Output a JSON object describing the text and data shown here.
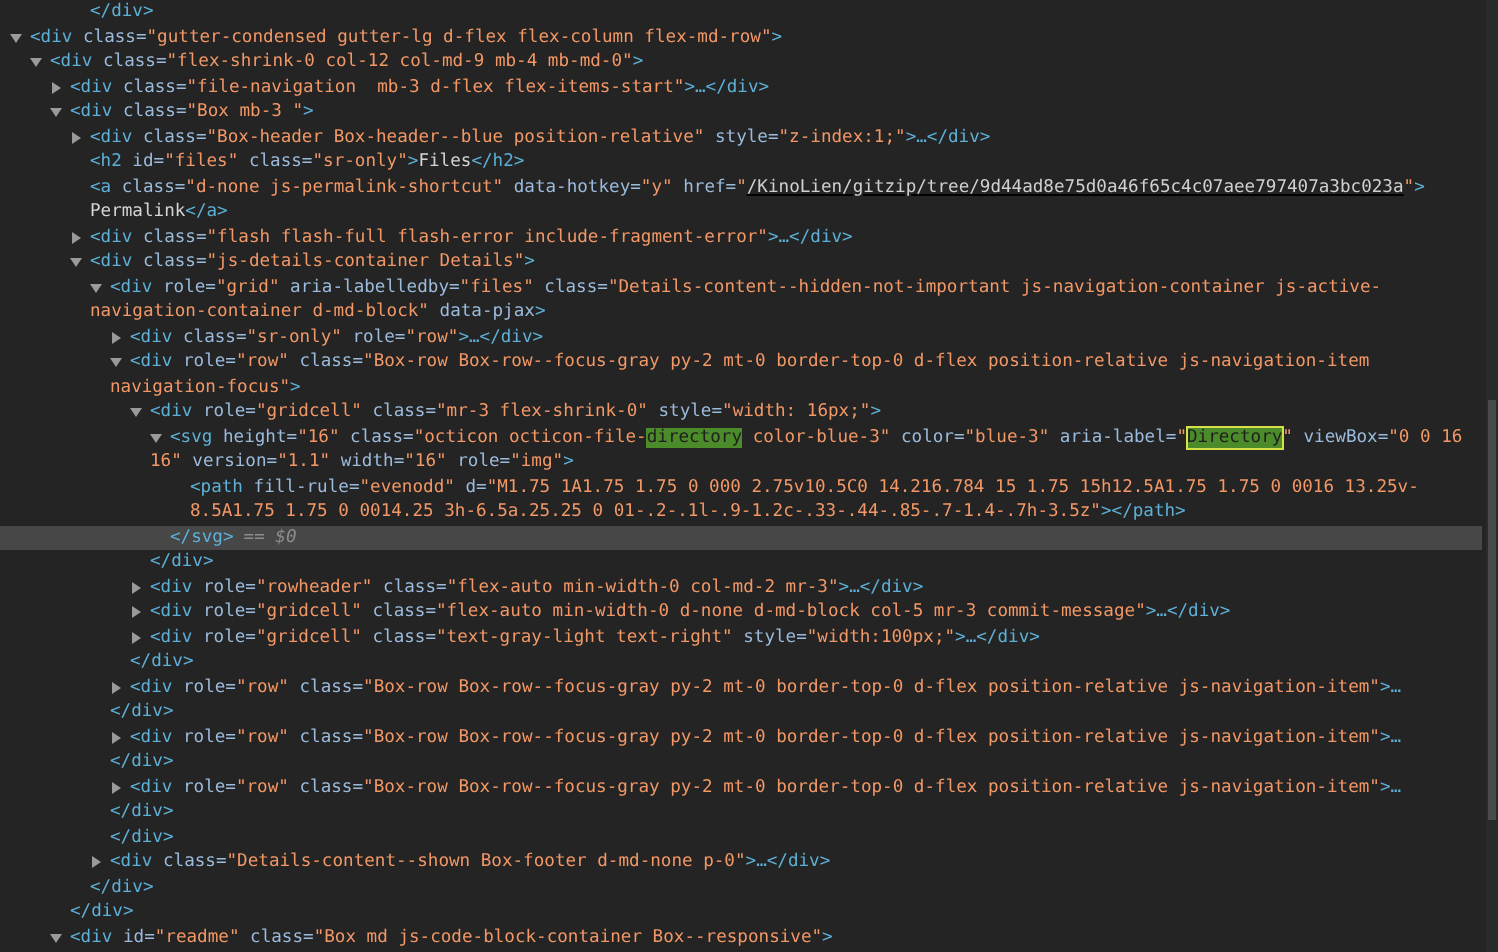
{
  "nodes": [
    {
      "children": [
        {
          "children": [
            {
              "children": [
                {
                  "close": "</div>",
                  "selected": false
                }
              ]
            }
          ]
        }
      ]
    },
    {
      "open": [
        "<div class=\"gutter-condensed gutter-lg d-flex flex-column flex-md-row\">"
      ],
      "expanded": true,
      "selected": false,
      "children": [
        {
          "open": [
            "<div class=\"flex-shrink-0 col-12 col-md-9 mb-4 mb-md-0\">"
          ],
          "expanded": true,
          "selected": false,
          "children": [
            {
              "open": [
                "<div class=\"file-navigation  mb-3 d-flex flex-items-start\">…</div>"
              ],
              "expanded": false,
              "selected": false
            },
            {
              "open": [
                "<div class=\"Box mb-3 \">"
              ],
              "expanded": true,
              "selected": false,
              "close": "</div>",
              "children": [
                {
                  "open": [
                    "<div class=\"Box-header Box-header--blue position-relative\" style=\"z-index:1;\">…</div>"
                  ],
                  "expanded": false,
                  "selected": false
                },
                {
                  "open": [
                    "<h2 id=\"files\" class=\"sr-only\">Files</h2>"
                  ],
                  "selected": false
                },
                {
                  "open": [
                    [
                      {
                        "text": "<a class=\"d-none js-permalink-shortcut\" data-hotkey=\"y\" href=\"",
                        "kind": "plain"
                      },
                      {
                        "text": "/KinoLien/gitzip/tree/9d44ad8e75d0a46f65c4c07aee797407a3bc023a",
                        "kind": "link"
                      },
                      {
                        "text": "\">",
                        "kind": "plain"
                      }
                    ],
                    "Permalink</a>"
                  ],
                  "selected": false
                },
                {
                  "open": [
                    "<div class=\"flash flash-full flash-error include-fragment-error\">…</div>"
                  ],
                  "expanded": false,
                  "selected": false
                },
                {
                  "open": [
                    "<div class=\"js-details-container Details\">"
                  ],
                  "expanded": true,
                  "selected": false,
                  "close": "</div>",
                  "children": [
                    {
                      "open": [
                        "<div role=\"grid\" aria-labelledby=\"files\" class=\"Details-content--hidden-not-important js-navigation-container js-active-",
                        "navigation-container d-md-block\" data-pjax>"
                      ],
                      "expanded": true,
                      "selected": false,
                      "close": "</div>",
                      "children": [
                        {
                          "open": [
                            "<div class=\"sr-only\" role=\"row\">…</div>"
                          ],
                          "expanded": false,
                          "selected": false
                        },
                        {
                          "open": [
                            "<div role=\"row\" class=\"Box-row Box-row--focus-gray py-2 mt-0 border-top-0 d-flex position-relative js-navigation-item",
                            "navigation-focus\">"
                          ],
                          "expanded": true,
                          "selected": false,
                          "close": "</div>",
                          "children": [
                            {
                              "open": [
                                "<div role=\"gridcell\" class=\"mr-3 flex-shrink-0\" style=\"width: 16px;\">"
                              ],
                              "expanded": true,
                              "selected": false,
                              "close": "</div>",
                              "children": [
                                {
                                  "open": [
                                    [
                                      {
                                        "text": "<svg height=\"16\" class=\"octicon octicon-file-",
                                        "kind": "plain"
                                      },
                                      {
                                        "text": "directory",
                                        "kind": "match"
                                      },
                                      {
                                        "text": " color-blue-3\" color=\"blue-3\" aria-label=\"",
                                        "kind": "plain"
                                      },
                                      {
                                        "text": "Directory",
                                        "kind": "current_match"
                                      },
                                      {
                                        "text": "\" viewBox=\"0 0 16",
                                        "kind": "plain"
                                      }
                                    ],
                                    "16\" version=\"1.1\" width=\"16\" role=\"img\">"
                                  ],
                                  "expanded": true,
                                  "selected": true,
                                  "marker": "== $0",
                                  "close": "</svg>",
                                  "children": [
                                    {
                                      "open": [
                                        "<path fill-rule=\"evenodd\" d=\"M1.75 1A1.75 1.75 0 000 2.75v10.5C0 14.216.784 15 1.75 15h12.5A1.75 1.75 0 0016 13.25v-",
                                        "8.5A1.75 1.75 0 0014.25 3h-6.5a.25.25 0 01-.2-.1l-.9-1.2c-.33-.44-.85-.7-1.4-.7h-3.5z\"></path>"
                                      ],
                                      "selected": false
                                    }
                                  ]
                                }
                              ]
                            },
                            {
                              "open": [
                                "<div role=\"rowheader\" class=\"flex-auto min-width-0 col-md-2 mr-3\">…</div>"
                              ],
                              "expanded": false,
                              "selected": false
                            },
                            {
                              "open": [
                                "<div role=\"gridcell\" class=\"flex-auto min-width-0 d-none d-md-block col-5 mr-3 commit-message\">…</div>"
                              ],
                              "expanded": false,
                              "selected": false
                            },
                            {
                              "open": [
                                "<div role=\"gridcell\" class=\"text-gray-light text-right\" style=\"width:100px;\">…</div>"
                              ],
                              "expanded": false,
                              "selected": false
                            }
                          ]
                        },
                        {
                          "open": [
                            "<div role=\"row\" class=\"Box-row Box-row--focus-gray py-2 mt-0 border-top-0 d-flex position-relative js-navigation-item\">…",
                            "</div>"
                          ],
                          "expanded": false,
                          "selected": false
                        },
                        {
                          "open": [
                            "<div role=\"row\" class=\"Box-row Box-row--focus-gray py-2 mt-0 border-top-0 d-flex position-relative js-navigation-item\">…",
                            "</div>"
                          ],
                          "expanded": false,
                          "selected": false
                        },
                        {
                          "open": [
                            "<div role=\"row\" class=\"Box-row Box-row--focus-gray py-2 mt-0 border-top-0 d-flex position-relative js-navigation-item\">…",
                            "</div>"
                          ],
                          "expanded": false,
                          "selected": false
                        }
                      ]
                    },
                    {
                      "open": [
                        "<div class=\"Details-content--shown Box-footer d-md-none p-0\">…</div>"
                      ],
                      "expanded": false,
                      "selected": false
                    }
                  ]
                }
              ]
            },
            {
              "open": [
                "<div id=\"readme\" class=\"Box md js-code-block-container Box--responsive\">"
              ],
              "expanded": true,
              "selected": false
            }
          ]
        }
      ]
    }
  ]
}
